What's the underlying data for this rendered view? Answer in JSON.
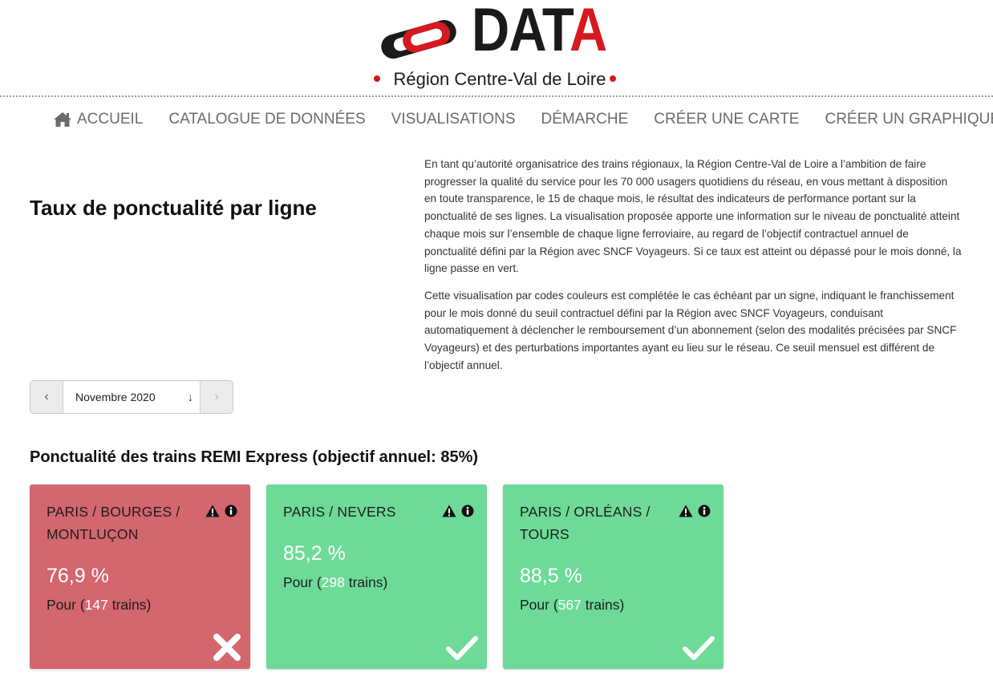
{
  "brand": {
    "logo_word": "DAT",
    "logo_word_last": "A",
    "logo_subtitle": "Région Centre-Val de Loire"
  },
  "nav": {
    "items": [
      {
        "label": "ACCUEIL",
        "icon": "home-icon"
      },
      {
        "label": "CATALOGUE DE DONNÉES"
      },
      {
        "label": "VISUALISATIONS"
      },
      {
        "label": "DÉMARCHE"
      },
      {
        "label": "CRÉER UNE CARTE"
      },
      {
        "label": "CRÉER UN GRAPHIQUE"
      }
    ]
  },
  "page": {
    "title": "Taux de ponctualité par ligne",
    "intro": [
      "En tant qu’autorité organisatrice des trains régionaux, la Région Centre-Val de Loire a l’ambition de faire progresser la qualité du service pour les 70 000 usagers quotidiens du réseau, en vous mettant à disposition en toute transparence, le 15 de chaque mois, le résultat des indicateurs de performance portant sur la ponctualité de ses lignes. La visualisation proposée apporte une information sur le niveau de ponctualité atteint chaque mois sur l’ensemble de chaque ligne ferroviaire, au regard de l’objectif contractuel annuel de ponctualité défini par la Région avec SNCF Voyageurs. Si ce taux est atteint ou dépassé pour le mois donné, la ligne passe en vert.",
      "Cette visualisation par codes couleurs est complétée le cas échéant par un signe, indiquant le franchissement pour le mois donné du seuil contractuel défini par la Région avec SNCF Voyageurs, conduisant automatiquement à déclencher le remboursement d’un abonnement (selon des modalités précisées par SNCF Voyageurs) et des perturbations importantes ayant eu lieu sur le réseau. Ce seuil mensuel est différent de l’objectif annuel."
    ]
  },
  "month_selector": {
    "prev_label": "‹",
    "value": "Novembre 2020",
    "dropdown_glyph": "↓",
    "next_label": "›"
  },
  "section": {
    "title": "Ponctualité des trains REMI Express (objectif annuel: 85%)"
  },
  "colors": {
    "below_objective": "#d4666e",
    "objective_met": "#6ddb97",
    "brand_red": "#d4191f"
  },
  "cards": [
    {
      "line": "PARIS / BOURGES / MONTLUÇON",
      "rate": "76,9 %",
      "count_prefix": "Pour (",
      "count": "147",
      "count_suffix": " trains)",
      "status": "cross-icon",
      "met": false
    },
    {
      "line": "PARIS / NEVERS",
      "rate": "85,2 %",
      "count_prefix": "Pour (",
      "count": "298",
      "count_suffix": " trains)",
      "status": "check-icon",
      "met": true
    },
    {
      "line": "PARIS / ORLÉANS / TOURS",
      "rate": "88,5 %",
      "count_prefix": "Pour (",
      "count": "567",
      "count_suffix": " trains)",
      "status": "check-icon",
      "met": true
    }
  ]
}
